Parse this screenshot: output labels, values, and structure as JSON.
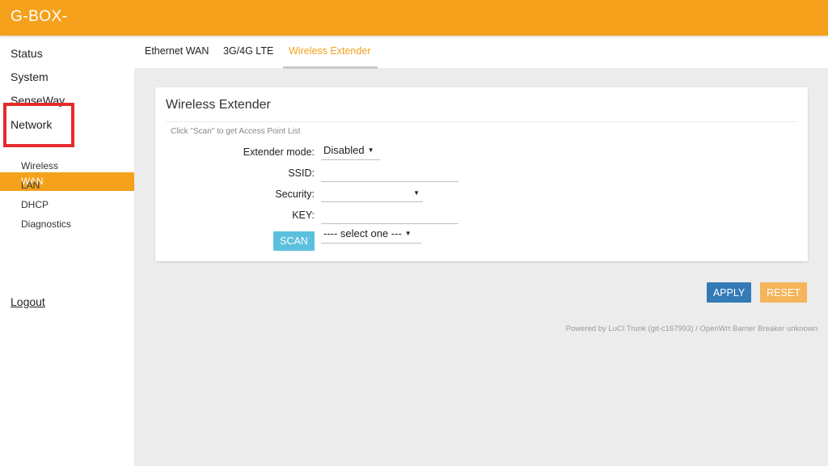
{
  "header": {
    "brand": "G-BOX-",
    "bg_color": "#f5a11c"
  },
  "sidebar": {
    "items": [
      {
        "label": "Status"
      },
      {
        "label": "System"
      },
      {
        "label": "SenseWay"
      },
      {
        "label": "Network"
      }
    ],
    "sub_items": [
      {
        "label": "WAN",
        "active": true
      },
      {
        "label": "Wireless"
      },
      {
        "label": "LAN"
      },
      {
        "label": "DHCP"
      },
      {
        "label": "Diagnostics"
      }
    ],
    "logout": "Logout"
  },
  "tabs": [
    {
      "label": "Ethernet WAN"
    },
    {
      "label": "3G/4G LTE"
    },
    {
      "label": "Wireless Extender",
      "active": true
    }
  ],
  "card": {
    "title": "Wireless Extender",
    "hint": "Click \"Scan\" to get Access Point List",
    "fields": {
      "extender_mode": {
        "label": "Extender mode:",
        "value": "Disabled"
      },
      "ssid": {
        "label": "SSID:",
        "value": ""
      },
      "security": {
        "label": "Security:",
        "value": ""
      },
      "key": {
        "label": "KEY:",
        "value": ""
      }
    },
    "scan_label": "SCAN",
    "ap_select_value": "---- select one ---"
  },
  "actions": {
    "apply": "APPLY",
    "reset": "RESET"
  },
  "footer": "Powered by LuCI Trunk (git-c167993) / OpenWrt Barrier Breaker unknown",
  "colors": {
    "accent": "#f5a11c",
    "apply": "#337ab7",
    "reset": "#f5b55a",
    "scan": "#5bc0de",
    "annotation": "#e52b2b"
  }
}
